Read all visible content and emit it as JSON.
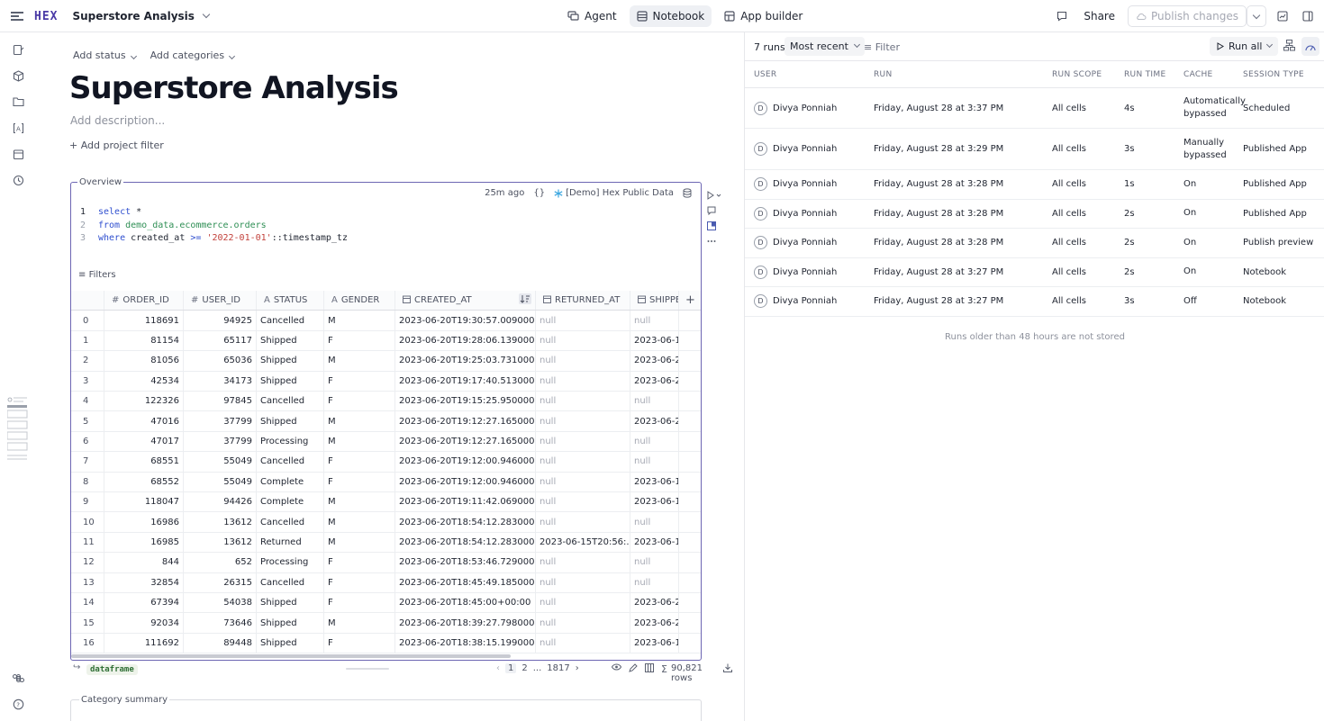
{
  "app": {
    "logo": "HEX",
    "project_name": "Superstore Analysis",
    "modes": [
      {
        "label": "Agent",
        "icon": "agent-icon"
      },
      {
        "label": "Notebook",
        "icon": "notebook-icon",
        "active": true
      },
      {
        "label": "App builder",
        "icon": "app-builder-icon"
      }
    ],
    "share_label": "Share",
    "publish_label": "Publish changes"
  },
  "notebook": {
    "add_status": "Add status",
    "add_categories": "Add categories",
    "title": "Superstore Analysis",
    "description_placeholder": "Add description...",
    "add_project_filter": "+ Add project filter",
    "cell": {
      "label": "Overview",
      "time_ago": "25m ago",
      "braces": "{}",
      "connection": "[Demo] Hex Public Data",
      "code_lines": [
        {
          "n": "1",
          "parts": [
            {
              "t": "select",
              "c": "kw"
            },
            {
              "t": " *",
              "c": ""
            }
          ]
        },
        {
          "n": "2",
          "parts": [
            {
              "t": "from",
              "c": "kw"
            },
            {
              "t": " demo_data.ecommerce.orders",
              "c": "tbl"
            }
          ]
        },
        {
          "n": "3",
          "parts": [
            {
              "t": "where",
              "c": "kw"
            },
            {
              "t": " created_at ",
              "c": ""
            },
            {
              "t": ">=",
              "c": "kw"
            },
            {
              "t": " ",
              "c": ""
            },
            {
              "t": "'2022-01-01'",
              "c": "str"
            },
            {
              "t": "::timestamp_tz",
              "c": ""
            }
          ]
        }
      ],
      "filters_label": "Filters",
      "columns": [
        {
          "label": "",
          "icon": ""
        },
        {
          "label": "ORDER_ID",
          "icon": "#"
        },
        {
          "label": "USER_ID",
          "icon": "#"
        },
        {
          "label": "STATUS",
          "icon": "A"
        },
        {
          "label": "GENDER",
          "icon": "A"
        },
        {
          "label": "CREATED_AT",
          "icon": "cal"
        },
        {
          "label": "RETURNED_AT",
          "icon": "cal"
        },
        {
          "label": "SHIPPE",
          "icon": "cal"
        }
      ],
      "rows": [
        [
          "0",
          "118691",
          "94925",
          "Cancelled",
          "M",
          "2023-06-20T19:30:57.009000...",
          "null",
          "null"
        ],
        [
          "1",
          "81154",
          "65117",
          "Shipped",
          "F",
          "2023-06-20T19:28:06.139000...",
          "null",
          "2023-06-1("
        ],
        [
          "2",
          "81056",
          "65036",
          "Shipped",
          "M",
          "2023-06-20T19:25:03.731000...",
          "null",
          "2023-06-2("
        ],
        [
          "3",
          "42534",
          "34173",
          "Shipped",
          "F",
          "2023-06-20T19:17:40.513000...",
          "null",
          "2023-06-2("
        ],
        [
          "4",
          "122326",
          "97845",
          "Cancelled",
          "F",
          "2023-06-20T19:15:25.950000...",
          "null",
          "null"
        ],
        [
          "5",
          "47016",
          "37799",
          "Shipped",
          "M",
          "2023-06-20T19:12:27.165000...",
          "null",
          "2023-06-2("
        ],
        [
          "6",
          "47017",
          "37799",
          "Processing",
          "M",
          "2023-06-20T19:12:27.165000...",
          "null",
          "null"
        ],
        [
          "7",
          "68551",
          "55049",
          "Cancelled",
          "F",
          "2023-06-20T19:12:00.946000...",
          "null",
          "null"
        ],
        [
          "8",
          "68552",
          "55049",
          "Complete",
          "F",
          "2023-06-20T19:12:00.946000...",
          "null",
          "2023-06-1("
        ],
        [
          "9",
          "118047",
          "94426",
          "Complete",
          "M",
          "2023-06-20T19:11:42.069000...",
          "null",
          "2023-06-1("
        ],
        [
          "10",
          "16986",
          "13612",
          "Cancelled",
          "M",
          "2023-06-20T18:54:12.283000...",
          "null",
          "null"
        ],
        [
          "11",
          "16985",
          "13612",
          "Returned",
          "M",
          "2023-06-20T18:54:12.283000...",
          "2023-06-15T20:56:...",
          "2023-06-1("
        ],
        [
          "12",
          "844",
          "652",
          "Processing",
          "F",
          "2023-06-20T18:53:46.729000...",
          "null",
          "null"
        ],
        [
          "13",
          "32854",
          "26315",
          "Cancelled",
          "F",
          "2023-06-20T18:45:49.185000...",
          "null",
          "null"
        ],
        [
          "14",
          "67394",
          "54038",
          "Shipped",
          "F",
          "2023-06-20T18:45:00+00:00",
          "null",
          "2023-06-2("
        ],
        [
          "15",
          "92034",
          "73646",
          "Shipped",
          "M",
          "2023-06-20T18:39:27.798000...",
          "null",
          "2023-06-2("
        ],
        [
          "16",
          "111692",
          "89448",
          "Shipped",
          "F",
          "2023-06-20T18:38:15.199000...",
          "null",
          "2023-06-1("
        ]
      ],
      "output_var": "dataframe",
      "pager": {
        "p1": "1",
        "p2": "2",
        "ellipsis": "...",
        "last": "1817"
      },
      "row_count": "90,821 rows"
    },
    "next_cell_label": "Category summary"
  },
  "runs_panel": {
    "run_count": "7 runs",
    "sort": "Most recent",
    "filter": "Filter",
    "run_all": "Run all",
    "headers": [
      "USER",
      "RUN",
      "RUN SCOPE",
      "RUN TIME",
      "CACHE",
      "SESSION TYPE"
    ],
    "rows": [
      {
        "initial": "D",
        "user": "Divya Ponniah",
        "run": "Friday, August 28 at 3:37 PM",
        "scope": "All cells",
        "time": "4s",
        "cache": "Automatically bypassed",
        "session": "Scheduled"
      },
      {
        "initial": "D",
        "user": "Divya Ponniah",
        "run": "Friday, August 28 at 3:29 PM",
        "scope": "All cells",
        "time": "3s",
        "cache": "Manually bypassed",
        "session": "Published App"
      },
      {
        "initial": "D",
        "user": "Divya Ponniah",
        "run": "Friday, August 28 at 3:28 PM",
        "scope": "All cells",
        "time": "1s",
        "cache": "On",
        "session": "Published App"
      },
      {
        "initial": "D",
        "user": "Divya Ponniah",
        "run": "Friday, August 28 at 3:28 PM",
        "scope": "All cells",
        "time": "2s",
        "cache": "On",
        "session": "Published App"
      },
      {
        "initial": "D",
        "user": "Divya Ponniah",
        "run": "Friday, August 28 at 3:28 PM",
        "scope": "All cells",
        "time": "2s",
        "cache": "On",
        "session": "Publish preview"
      },
      {
        "initial": "D",
        "user": "Divya Ponniah",
        "run": "Friday, August 28 at 3:27 PM",
        "scope": "All cells",
        "time": "2s",
        "cache": "On",
        "session": "Notebook"
      },
      {
        "initial": "D",
        "user": "Divya Ponniah",
        "run": "Friday, August 28 at 3:27 PM",
        "scope": "All cells",
        "time": "3s",
        "cache": "Off",
        "session": "Notebook"
      }
    ],
    "older_note": "Runs older than 48 hours are not stored"
  }
}
